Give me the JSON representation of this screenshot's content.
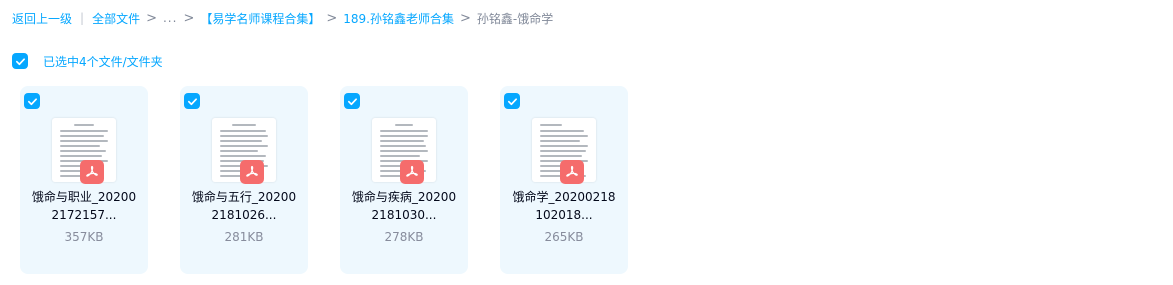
{
  "breadcrumb": {
    "back": "返回上一级",
    "all_files": "全部文件",
    "ellipsis": "...",
    "folder1": "【易学名师课程合集】",
    "folder2": "189.孙铭鑫老师合集",
    "current": "孙铭鑫-饿命学"
  },
  "selection": {
    "text": "已选中4个文件/文件夹"
  },
  "files": [
    {
      "line1": "饿命与职业_20200",
      "line2": "2172157...",
      "size": "357KB"
    },
    {
      "line1": "饿命与五行_20200",
      "line2": "2181026...",
      "size": "281KB"
    },
    {
      "line1": "饿命与疾病_20200",
      "line2": "2181030...",
      "size": "278KB"
    },
    {
      "line1": "饿命学_20200218",
      "line2": "102018...",
      "size": "265KB"
    }
  ],
  "colors": {
    "accent": "#06a7ff",
    "pdf": "#f56c6c",
    "card_bg": "#eef8fe"
  },
  "icons": {
    "checkbox": "checkbox-checked-icon",
    "file_type": "pdf-icon",
    "separator": "chevron-right-icon"
  }
}
